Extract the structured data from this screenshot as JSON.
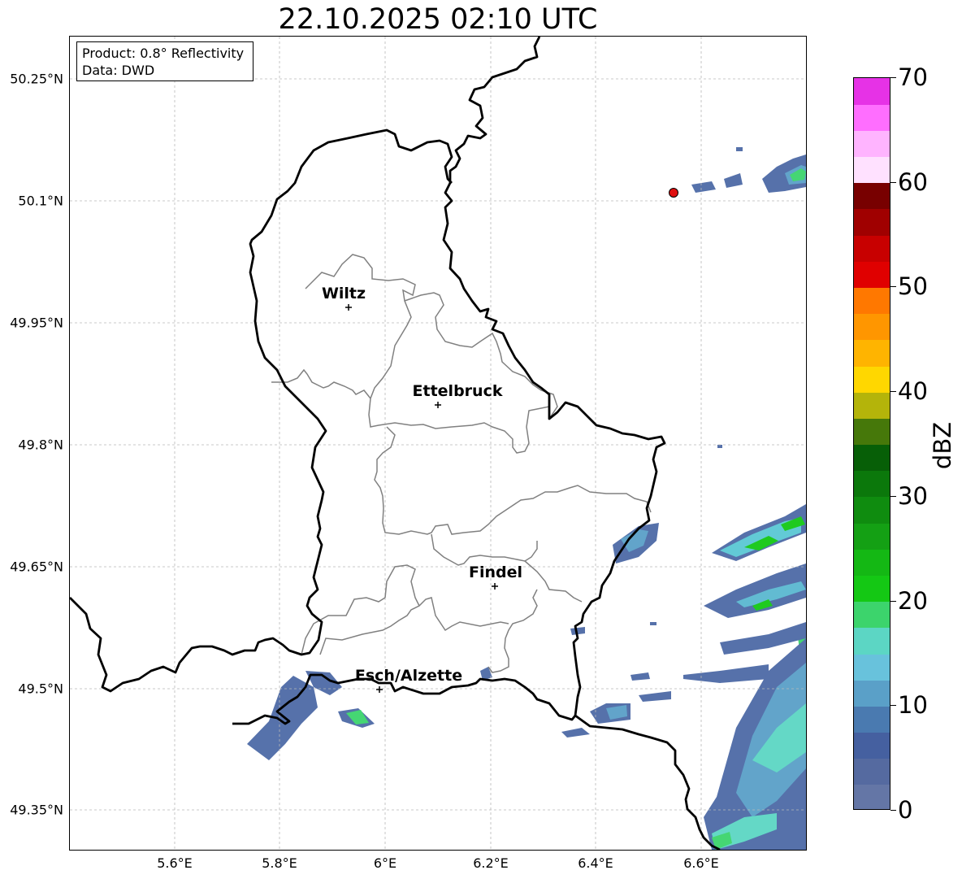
{
  "title": "22.10.2025 02:10 UTC",
  "info_box": {
    "line1": "Product: 0.8° Reflectivity",
    "line2": "Data: DWD"
  },
  "lat_ticks": [
    "50.25°N",
    "50.1°N",
    "49.95°N",
    "49.8°N",
    "49.65°N",
    "49.5°N",
    "49.35°N"
  ],
  "lon_ticks": [
    "5.6°E",
    "5.8°E",
    "6°E",
    "6.2°E",
    "6.4°E",
    "6.6°E"
  ],
  "cities": [
    {
      "name": "Wiltz"
    },
    {
      "name": "Ettelbruck"
    },
    {
      "name": "Findel"
    },
    {
      "name": "Esch/Alzette"
    }
  ],
  "colorbar": {
    "label": "dBZ",
    "min": 0,
    "max": 70,
    "tick_values": [
      0,
      10,
      20,
      30,
      40,
      50,
      60,
      70
    ],
    "tick_labels": [
      "0",
      "10",
      "20",
      "30",
      "40",
      "50",
      "60",
      "70"
    ],
    "colors": [
      "#6476a6",
      "#556aa0",
      "#4560a0",
      "#4a7ab0",
      "#5aa0c8",
      "#68c2dc",
      "#5cd6c4",
      "#3cd46c",
      "#14c814",
      "#14b814",
      "#14a014",
      "#0f8c0f",
      "#0b780b",
      "#075f07",
      "#46780a",
      "#b4b40a",
      "#ffd700",
      "#ffb400",
      "#ff9600",
      "#ff7800",
      "#e00000",
      "#c80000",
      "#a00000",
      "#780000",
      "#ffe1ff",
      "#ffb4ff",
      "#ff6eff",
      "#e632e6"
    ]
  },
  "marker": {
    "color": "#e01010"
  }
}
